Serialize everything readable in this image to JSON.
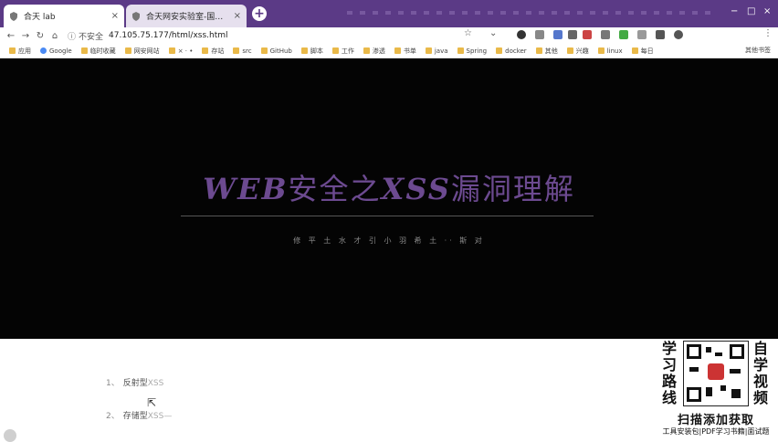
{
  "tabs": [
    {
      "title": "合天 lab",
      "active": true
    },
    {
      "title": "合天网安实验室-国内最大的MOOC",
      "active": false
    }
  ],
  "toolbar": {
    "security_label": "不安全",
    "url": "47.105.75.177/html/xss.html"
  },
  "bookmarks": [
    {
      "label": "应用",
      "icon": "apps-icon"
    },
    {
      "label": "Google",
      "icon": "google-icon"
    },
    {
      "label": "临时收藏",
      "icon": "folder-icon"
    },
    {
      "label": "网安网站",
      "icon": "folder-icon"
    },
    {
      "label": "× · •",
      "icon": "folder-icon"
    },
    {
      "label": "存站",
      "icon": "folder-icon"
    },
    {
      "label": "src",
      "icon": "folder-icon"
    },
    {
      "label": "GitHub",
      "icon": "folder-icon"
    },
    {
      "label": "脚本",
      "icon": "folder-icon"
    },
    {
      "label": "工作",
      "icon": "folder-icon"
    },
    {
      "label": "渗透",
      "icon": "folder-icon"
    },
    {
      "label": "书单",
      "icon": "folder-icon"
    },
    {
      "label": "java",
      "icon": "folder-icon"
    },
    {
      "label": "Spring",
      "icon": "folder-icon"
    },
    {
      "label": "docker",
      "icon": "folder-icon"
    },
    {
      "label": "其他",
      "icon": "folder-icon"
    },
    {
      "label": "兴趣",
      "icon": "folder-icon"
    },
    {
      "label": "linux",
      "icon": "folder-icon"
    },
    {
      "label": "每日",
      "icon": "folder-icon"
    }
  ],
  "bookmarks_other": "其他书签",
  "hero": {
    "title_latin_1": "WEB",
    "title_cjk_1": "安全之",
    "title_latin_2": "XSS",
    "title_cjk_2": "漏洞理解",
    "subtitle": "修 平 土 水 才 引 小 羽 希 土 ·· 斯 对"
  },
  "content": {
    "items": [
      {
        "number": "1、",
        "label": "反射型",
        "suffix": "XSS"
      },
      {
        "number": "2、",
        "label": "存储型",
        "suffix": "XSS—"
      }
    ]
  },
  "promo": {
    "left_vertical": [
      "学",
      "习",
      "路",
      "线"
    ],
    "right_vertical": [
      "自",
      "学",
      "视",
      "频"
    ],
    "banner": "扫描添加获取",
    "footer": "工具安装包|PDF学习书籍|面试题"
  },
  "colors": {
    "tab_strip": "#5b3a86",
    "hero_bg": "#040404",
    "hero_title": "#6c4a90"
  }
}
